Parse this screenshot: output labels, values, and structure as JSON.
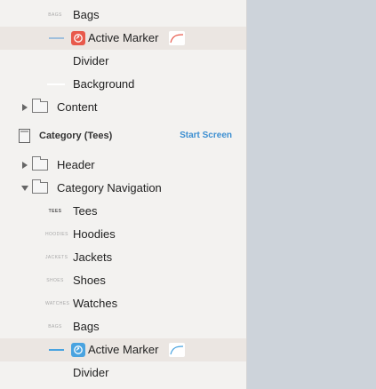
{
  "layers": {
    "group1": {
      "bags": {
        "label": "Bags",
        "thumb": "BAGS"
      },
      "active_marker": {
        "label": "Active Marker",
        "symbol_color": "#e8594b",
        "curve_color": "#e8594b"
      },
      "divider": {
        "label": "Divider"
      },
      "background": {
        "label": "Background"
      },
      "content": {
        "label": "Content"
      }
    },
    "artboard": {
      "title": "Category (Tees)",
      "action": "Start Screen"
    },
    "group2": {
      "header": {
        "label": "Header"
      },
      "category_navigation": {
        "label": "Category Navigation"
      },
      "items": [
        {
          "label": "Tees",
          "thumb": "TEES"
        },
        {
          "label": "Hoodies",
          "thumb": "HOODIES"
        },
        {
          "label": "Jackets",
          "thumb": "JACKETS"
        },
        {
          "label": "Shoes",
          "thumb": "SHOES"
        },
        {
          "label": "Watches",
          "thumb": "WATCHES"
        },
        {
          "label": "Bags",
          "thumb": "BAGS"
        }
      ],
      "active_marker": {
        "label": "Active Marker",
        "symbol_color": "#49a3e0",
        "curve_color": "#49a3e0"
      },
      "divider": {
        "label": "Divider"
      }
    }
  },
  "colors": {
    "selection": "#ebe6e2",
    "accent": "#3d8fd1",
    "canvas": "#cdd3da"
  }
}
